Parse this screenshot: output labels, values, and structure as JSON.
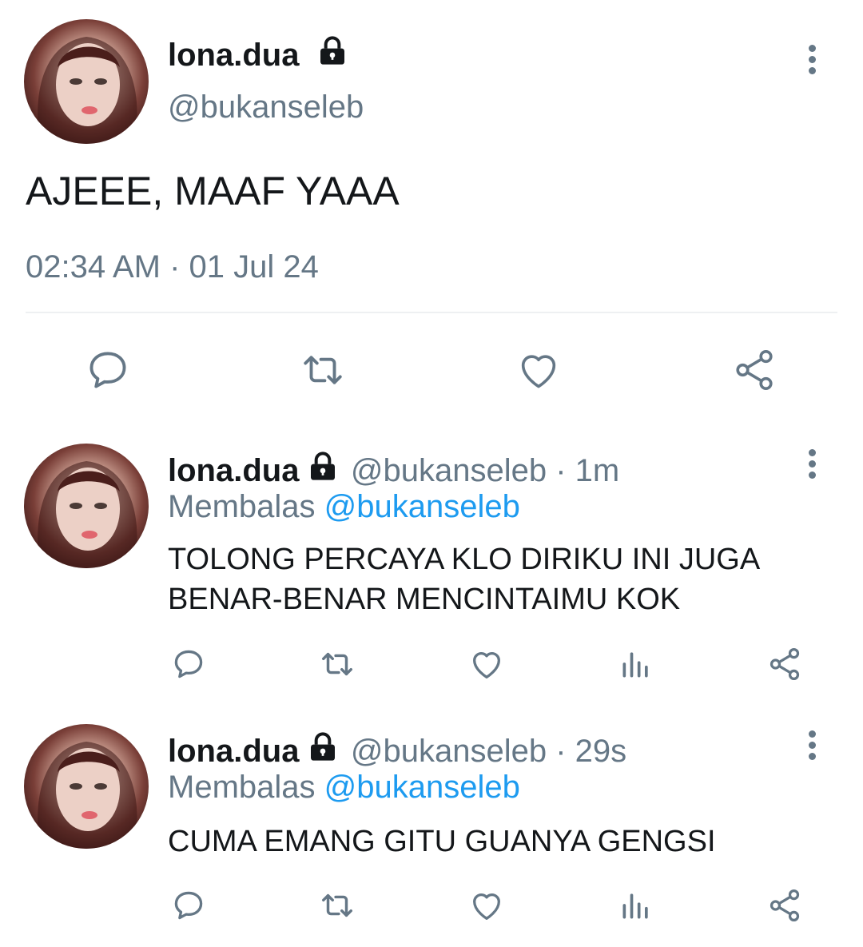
{
  "main_tweet": {
    "display_name": "lona.dua",
    "handle": "@bukanseleb",
    "text": "AJEEE, MAAF YAAA",
    "timestamp": "02:34 AM · 01 Jul 24",
    "actions": [
      "reply-icon",
      "retweet-icon",
      "like-icon",
      "share-icon"
    ]
  },
  "replies": [
    {
      "display_name": "lona.dua",
      "handle_time": "@bukanseleb · 1m",
      "reply_label": "Membalas",
      "reply_to": "@bukanseleb",
      "text": "TOLONG PERCAYA KLO DIRIKU INI JUGA BENAR-BENAR MENCINTAIMU KOK"
    },
    {
      "display_name": "lona.dua",
      "handle_time": "@bukanseleb · 29s",
      "reply_label": "Membalas",
      "reply_to": "@bukanseleb",
      "text": "CUMA EMANG GITU GUANYA GENGSI"
    }
  ],
  "colors": {
    "text": "#14171a",
    "secondary": "#657786",
    "mention": "#1d9bf0"
  }
}
